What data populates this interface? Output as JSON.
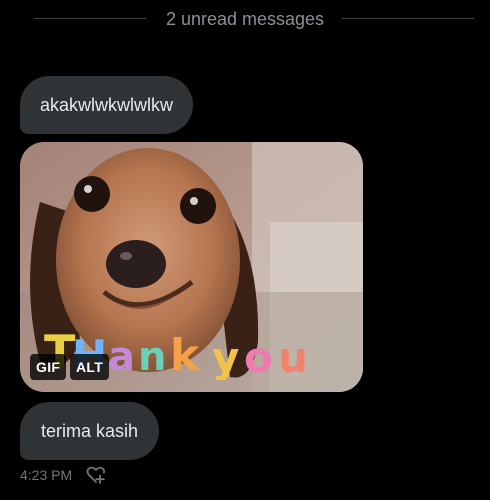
{
  "divider": {
    "label": "2 unread messages"
  },
  "messages": [
    {
      "text": "akakwlwkwlwlkw"
    },
    {
      "gif": {
        "caption": "Thank you",
        "badge_gif": "GIF",
        "badge_alt": "ALT"
      }
    },
    {
      "text": "terima kasih"
    }
  ],
  "meta": {
    "time": "4:23 PM",
    "react_icon": "heart-plus-icon"
  },
  "colors": {
    "background": "#000000",
    "bubble": "#2f3336",
    "text": "#e7e9ea",
    "muted": "#71767b",
    "divider_line": "#3e4144"
  }
}
